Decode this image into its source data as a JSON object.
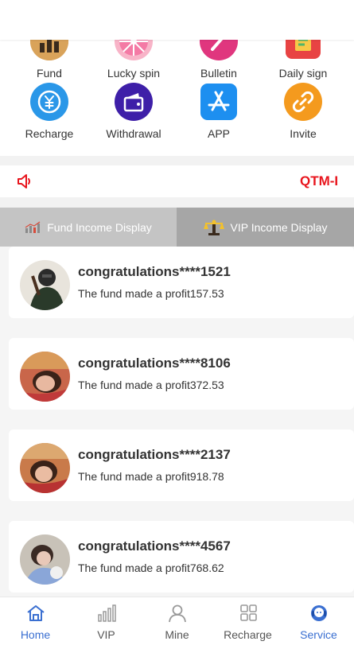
{
  "menu": {
    "row1": [
      {
        "label": "Fund",
        "color": "#d9a35a",
        "icon": "fund-icon"
      },
      {
        "label": "Lucky spin",
        "color": "#f47aa5",
        "icon": "wheel-icon"
      },
      {
        "label": "Bulletin",
        "color": "#e0367e",
        "icon": "bulletin-icon"
      },
      {
        "label": "Daily sign",
        "color": "#e84343",
        "icon": "daily-sign-icon"
      }
    ],
    "row2": [
      {
        "label": "Recharge",
        "color": "#2a97e8",
        "icon": "yen-icon"
      },
      {
        "label": "Withdrawal",
        "color": "#3e1fa8",
        "icon": "wallet-icon"
      },
      {
        "label": "APP",
        "color": "#1d8ff0",
        "icon": "app-store-icon"
      },
      {
        "label": "Invite",
        "color": "#f49a1e",
        "icon": "link-icon"
      }
    ]
  },
  "notice": {
    "text": "QTM-I"
  },
  "tabs": {
    "fund": "Fund Income Display",
    "vip": "VIP Income Display"
  },
  "records": [
    {
      "name": "congratulations****1521",
      "message": "The fund made a profit157.53"
    },
    {
      "name": "congratulations****8106",
      "message": "The fund made a profit372.53"
    },
    {
      "name": "congratulations****2137",
      "message": "The fund made a profit918.78"
    },
    {
      "name": "congratulations****4567",
      "message": "The fund made a profit768.62"
    }
  ],
  "nav": [
    {
      "label": "Home",
      "icon": "home-icon",
      "active": true
    },
    {
      "label": "VIP",
      "icon": "bar-chart-icon",
      "active": false
    },
    {
      "label": "Mine",
      "icon": "person-icon",
      "active": false
    },
    {
      "label": "Recharge",
      "icon": "grid-icon",
      "active": false
    },
    {
      "label": "Service",
      "icon": "headset-icon",
      "active": false
    }
  ],
  "colors": {
    "accent": "#3a6fd1",
    "notice": "#e8151d"
  }
}
